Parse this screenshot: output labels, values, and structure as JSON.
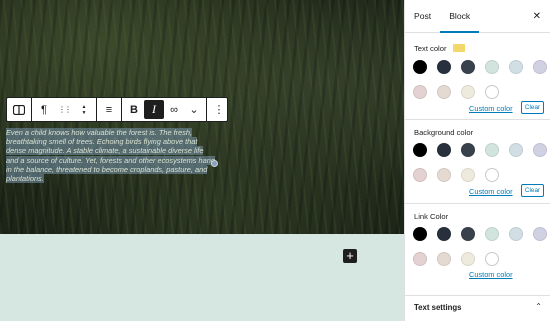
{
  "paragraph": {
    "text": "Even a child knows how valuable the forest is. The fresh, breathtaking smell of trees. Echoing birds flying above that dense magnitude. A stable climate, a sustainable diverse life and a source of culture. Yet, forests and other ecosystems hang in the balance, threatened to become croplands, pasture, and plantations."
  },
  "toolbar": {
    "block_type_icon": "columns-icon",
    "paragraph_icon": "¶",
    "drag_icon": "⋮⋮",
    "move_up_icon": "▲",
    "move_down_icon": "▼",
    "align_icon": "≡",
    "bold_label": "B",
    "italic_label": "I",
    "link_icon": "∞",
    "more_rich_icon": "⌄",
    "options_icon": "⋮"
  },
  "add_block_label": "+",
  "sidebar": {
    "tabs": [
      {
        "label": "Post",
        "active": false
      },
      {
        "label": "Block",
        "active": true
      }
    ],
    "close_label": "✕",
    "text_color": {
      "title": "Text color",
      "current_color": "#f3d76a",
      "custom_label": "Custom color",
      "clear_label": "Clear"
    },
    "background_color": {
      "title": "Background color",
      "custom_label": "Custom color",
      "clear_label": "Clear"
    },
    "link_color": {
      "title": "Link Color",
      "custom_label": "Custom color"
    },
    "palette": [
      "#000000",
      "#28303d",
      "#39414d",
      "#d1e4dd",
      "#d1dfe4",
      "#d1d1e4",
      "#e4d1d1",
      "#e4dad1",
      "#eeeadd",
      "#ffffff"
    ],
    "text_settings_label": "Text settings",
    "text_settings_chevron": "⌃"
  }
}
